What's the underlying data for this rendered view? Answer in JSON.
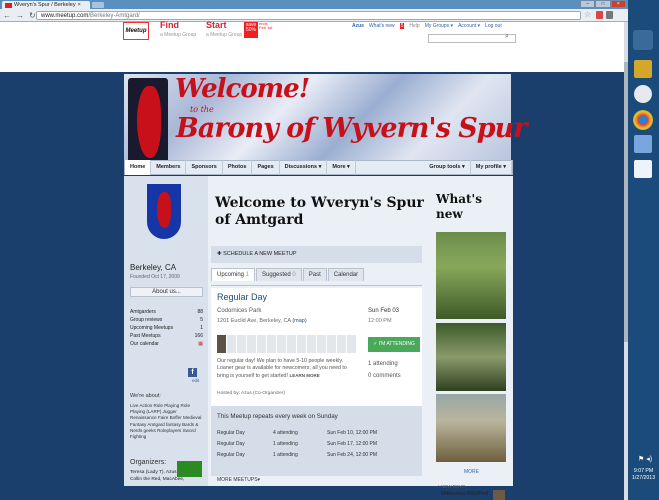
{
  "browser": {
    "tab_title": "Wveryn's Spur / Berkeley",
    "tab_close": "×",
    "url_host": "www.meetup.com",
    "url_path": "/Berkeley-Amtgard/"
  },
  "meetup": {
    "logo": "Meetup",
    "find_label": "Find",
    "find_sub": "a Meetup Group",
    "start_label": "Start",
    "start_sub": "a Meetup Group",
    "promo_line1": "save",
    "promo_line2": "50%",
    "promo_line3": "ends Feb 1st",
    "user_name": "Azus",
    "whats_new": "What's new",
    "whats_new_count": "5",
    "help": "Help",
    "my_groups": "My Groups ▾",
    "account": "Account ▾",
    "logout": "Log out"
  },
  "banner": {
    "welcome": "Welcome!",
    "to_the": "to the",
    "barony": "Barony of Wyvern's Spur"
  },
  "group_nav": {
    "items": [
      "Home",
      "Members",
      "Sponsors",
      "Photos",
      "Pages",
      "Discussions ▾",
      "More ▾"
    ],
    "group_tools": "Group tools ▾",
    "my_profile": "My profile ▾"
  },
  "sidebar": {
    "city": "Berkeley, CA",
    "founded": "Founded Oct 17, 2009",
    "about": "About us...",
    "stats": [
      {
        "label": "Amtgarders",
        "value": "88"
      },
      {
        "label": "Group reviews",
        "value": "5"
      },
      {
        "label": "Upcoming Meetups",
        "value": "1"
      },
      {
        "label": "Past Meetups",
        "value": "166"
      },
      {
        "label": "Our calendar",
        "value": ""
      }
    ],
    "fb_edit": "edit",
    "we_are_about": "We're about:",
    "topics": "Live Action Role Playing   Role Playing (LARP)   Jugger   Renaissance Faire   Boffer   Medieval Fantasy   Amtgard   fantasy   Bards & Nerds   geeks   Roleplayers   Sword Fighting",
    "organizers_title": "Organizers:",
    "organizers": "Teresa (Lady T), Azus, Collin the Red, MacAbee,"
  },
  "main": {
    "title": "Welcome to Wveryn's Spur of Amtgard",
    "schedule": "SCHEDULE A NEW MEETUP",
    "tabs": [
      {
        "label": "Upcoming",
        "count": "1"
      },
      {
        "label": "Suggested",
        "count": "0"
      },
      {
        "label": "Past",
        "count": ""
      },
      {
        "label": "Calendar",
        "count": ""
      }
    ],
    "event": {
      "title": "Regular Day",
      "venue": "Codornices Park",
      "address": "1201 Euclid Ave, Berkeley, CA",
      "map": "(map)",
      "date": "Sun Feb 03",
      "time": "12:00 PM",
      "attend_button": "✓ I'M ATTENDING",
      "description": "Our regular day! We plan to have 5-10 people weekly. Loaner gear is available for newcomers; all you need to bring is yourself to get started!",
      "learn_more": "LEARN MORE",
      "attending": "1 attending",
      "comments": "0 comments",
      "hosted_by": "Hosted by: Azus (Co-Organizer)"
    },
    "repeat_title": "This Meetup repeats every week on Sunday",
    "repeats": [
      {
        "name": "Regular Day",
        "attending": "4 attending",
        "when": "Sun Feb 10, 12:00 PM"
      },
      {
        "name": "Regular Day",
        "attending": "1 attending",
        "when": "Sun Feb 17, 12:00 PM"
      },
      {
        "name": "Regular Day",
        "attending": "1 attending",
        "when": "Sun Feb 24, 12:00 PM"
      }
    ],
    "more_meetups": "MORE MEETUPS▾"
  },
  "whats_new": {
    "title": "What's new",
    "more": "MORE",
    "new_rsvp": "✓ NEW RSVP",
    "rsvp_name": "Millennius RSVPed"
  },
  "taskbar": {
    "time": "9:07 PM",
    "date": "1/27/2013"
  }
}
